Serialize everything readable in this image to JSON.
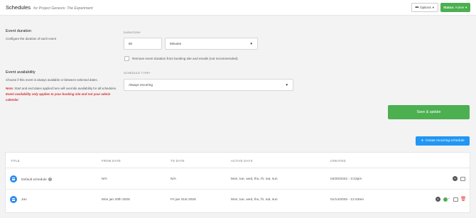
{
  "header": {
    "title": "Schedules",
    "subtitle": "for Project Genesis: The Experiment",
    "options_label": "Options",
    "status_prefix": "Status:",
    "status_value": "Active"
  },
  "event_duration": {
    "title": "Event duration",
    "description": "Configure the duration of each event",
    "field_label": "DURATION",
    "value": "60",
    "unit": "Minutes",
    "checkbox_label": "Remove event duration from booking site and emails (not recommended)",
    "checkbox_checked": false
  },
  "event_availability": {
    "title": "Event availability",
    "description": "Choose if this event is always available or between selected dates.",
    "note_prefix": "Note:",
    "note_text": " Start and end dates applied here will override availability for all schedules.",
    "note_emphasis": " Event availability only applies to your booking site and not your admin calendar",
    "field_label": "SCHEDULE TYPE",
    "schedule_type": "Always recurring"
  },
  "actions": {
    "save_label": "Save & update",
    "create_label": "Create recurring schedule"
  },
  "table": {
    "columns": [
      "TITLE",
      "FROM DATE",
      "TO DATE",
      "ACTIVE DAYS",
      "CREATED"
    ],
    "rows": [
      {
        "title": "Default schedule",
        "from": "N/A",
        "to": "N/A",
        "days": "Mon, tue, wed, thu, fri, sat, sun",
        "created": "04/20/2022 - 3:22pm"
      },
      {
        "title": "Jan",
        "from": "Mon jan 20th 2025",
        "to": "Fri jan 31st 2025",
        "days": "Mon, tue, wed, thu, fri, sat, sun",
        "created": "01/14/2025 - 12:43am"
      }
    ]
  },
  "colors": {
    "primary_green": "#4caf50",
    "primary_blue": "#2196f3",
    "danger_red": "#d32f2f",
    "background": "#f3f3f4"
  }
}
